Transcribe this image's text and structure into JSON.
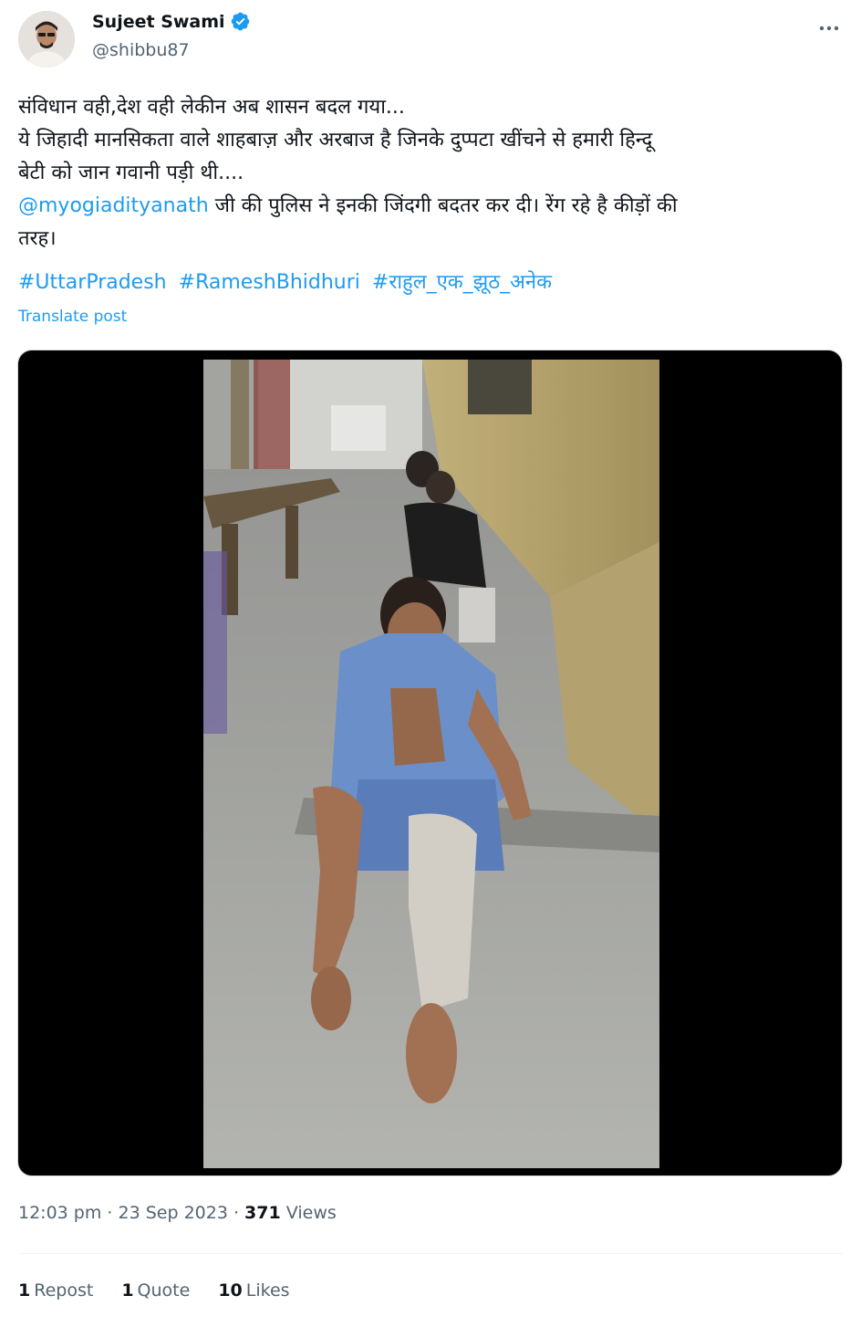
{
  "author": {
    "display_name": "Sujeet Swami",
    "handle": "@shibbu87",
    "verified_color": "#1d9bf0"
  },
  "tweet": {
    "line1": "संविधान वही,देश वही लेकीन अब शासन बदल गया...",
    "line2": "ये जिहादी मानसिकता वाले शाहबाज़ और अरबाज  है जिनके दुप्पटा खींचने से हमारी हिन्दू",
    "line3": "बेटी को जान गवानी पड़ी थी....",
    "mention": "@myogiadityanath",
    "line4_rest": " जी की पुलिस ने इनकी जिंदगी बदतर कर दी। रेंग रहे है कीड़ों की",
    "line5": "तरह।",
    "hashtags": [
      "#UttarPradesh",
      "#RameshBhidhuri",
      "#राहुल_एक_झूठ_अनेक"
    ],
    "translate_label": "Translate post"
  },
  "media": {
    "type": "video",
    "icon": "video-frame"
  },
  "meta": {
    "time": "12:03 pm",
    "separator": " · ",
    "date": "23 Sep 2023",
    "views_count": "371",
    "views_label": "Views"
  },
  "stats": {
    "reposts_count": "1",
    "reposts_label": "Repost",
    "quotes_count": "1",
    "quotes_label": "Quote",
    "likes_count": "10",
    "likes_label": "Likes"
  },
  "colors": {
    "link": "#1d9bf0",
    "text": "#0f1419",
    "secondary": "#536471"
  }
}
